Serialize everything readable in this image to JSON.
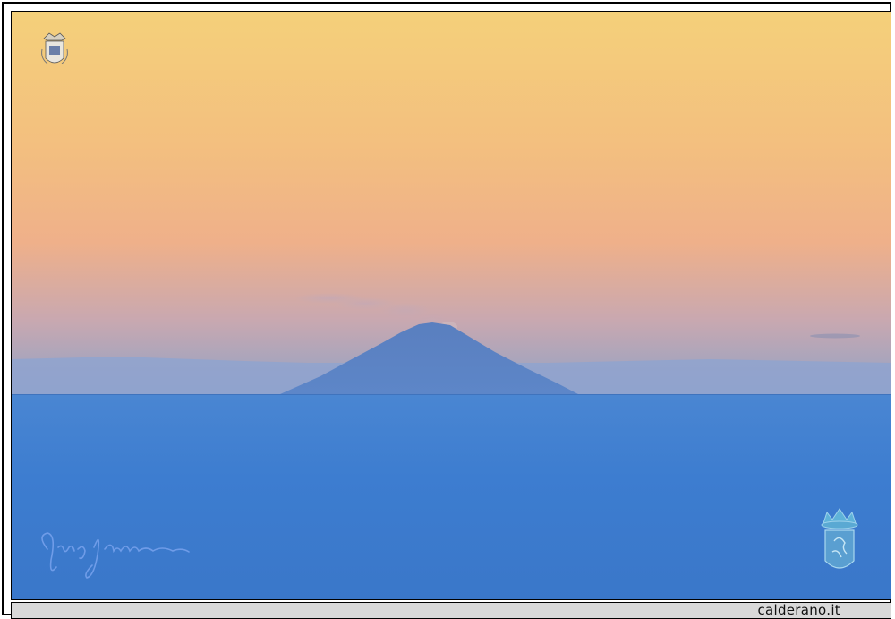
{
  "footer": {
    "site": "calderano.it"
  },
  "scene": {
    "subject": "volcano-island-at-dawn",
    "sky_top_color": "#f3cf7c",
    "sky_mid_color": "#f1b786",
    "sky_haze_color": "#a7a6c4",
    "sea_color": "#3f7fd1",
    "volcano_color": "#5d84c4"
  },
  "marks": {
    "crest_icon": "coat-of-arms-icon",
    "emblem_icon": "crowned-shield-icon",
    "signature_icon": "signature-icon"
  }
}
